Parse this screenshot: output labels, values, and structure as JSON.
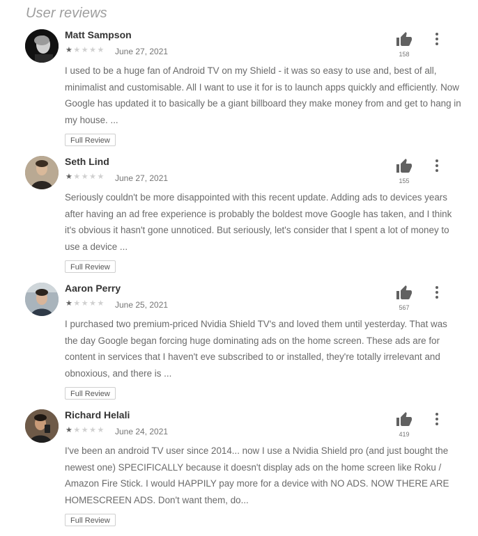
{
  "section_title": "User reviews",
  "full_review_label": "Full Review",
  "rating_max": 5,
  "reviews": [
    {
      "author": "Matt Sampson",
      "rating": 1,
      "date": "June 27, 2021",
      "helpful_count": "158",
      "text": "I used to be a huge fan of Android TV on my Shield - it was so easy to use and, best of all, minimalist and customisable. All I want to use it for is to launch apps quickly and efficiently. Now Google has updated it to basically be a giant billboard they make money from and get to hang in my house. ..."
    },
    {
      "author": "Seth Lind",
      "rating": 1,
      "date": "June 27, 2021",
      "helpful_count": "155",
      "text": "Seriously couldn't be more disappointed with this recent update. Adding ads to devices years after having an ad free experience is probably the boldest move Google has taken, and I think it's obvious it hasn't gone unnoticed. But seriously, let's consider that I spent a lot of money to use a device ..."
    },
    {
      "author": "Aaron Perry",
      "rating": 1,
      "date": "June 25, 2021",
      "helpful_count": "567",
      "text": "I purchased two premium-priced Nvidia Shield TV's and loved them until yesterday. That was the day Google began forcing huge dominating ads on the home screen. These ads are for content in services that I haven't eve subscribed to or installed, they're totally irrelevant and obnoxious, and there is ..."
    },
    {
      "author": "Richard Helali",
      "rating": 1,
      "date": "June 24, 2021",
      "helpful_count": "419",
      "text": "I've been an android TV user since 2014... now I use a Nvidia Shield pro (and just bought the newest one) SPECIFICALLY because it doesn't display ads on the home screen like Roku / Amazon Fire Stick. I would HAPPILY pay more for a device with NO ADS. NOW THERE ARE HOMESCREEN ADS. Don't want them, do..."
    }
  ],
  "colors": {
    "title": "#9e9e9e",
    "author": "#333333",
    "body": "#6a6a6a",
    "star_on": "#616161",
    "star_off": "#d0d0d0",
    "icon": "#616161"
  }
}
